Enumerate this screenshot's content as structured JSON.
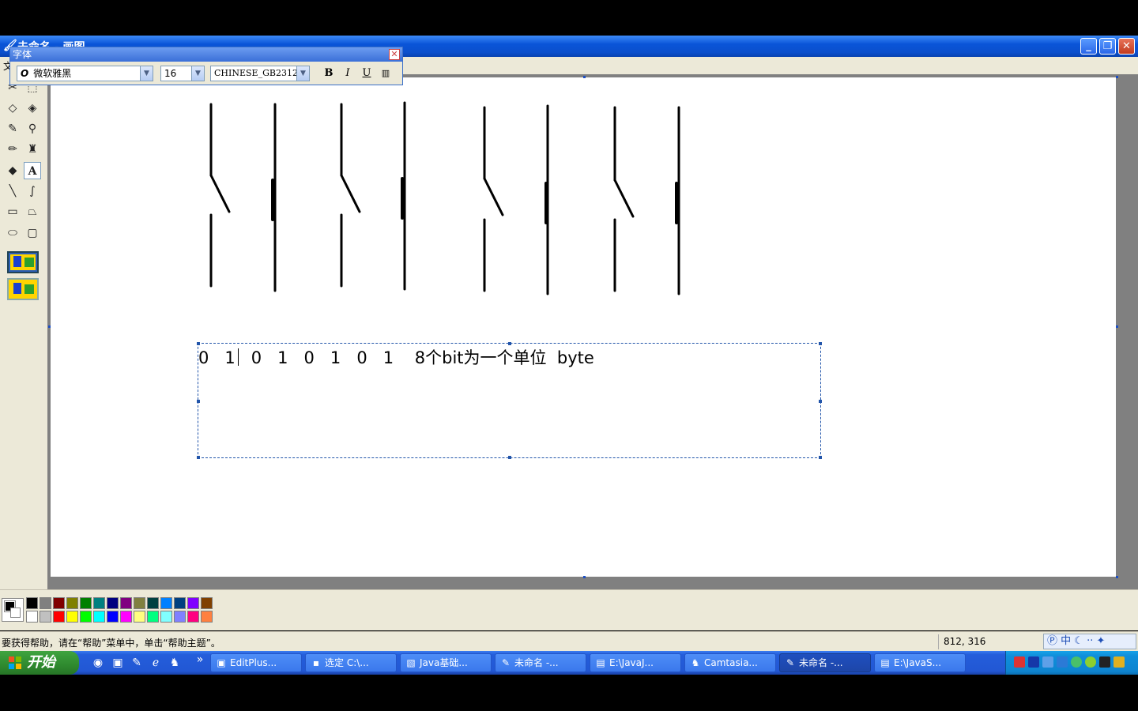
{
  "window": {
    "title": "未命名 - 画图"
  },
  "menu": {
    "first": "文"
  },
  "font_toolbar": {
    "title": "字体",
    "font_name": "微软雅黑",
    "font_size": "16",
    "charset": "CHINESE_GB2312",
    "bold": "B",
    "italic": "I",
    "underline": "U"
  },
  "tools": [
    "free-select",
    "select",
    "eraser",
    "fill",
    "picker",
    "magnifier",
    "pencil",
    "brush",
    "airbrush",
    "text",
    "line",
    "curve",
    "rectangle",
    "polygon",
    "ellipse",
    "rounded-rectangle"
  ],
  "canvas": {
    "text": "0   1   0   1   0   1   0   1    8个bit为一个单位  byte"
  },
  "palette": {
    "row1": [
      "#000000",
      "#808080",
      "#800000",
      "#808000",
      "#008000",
      "#008080",
      "#000080",
      "#800080",
      "#808040",
      "#004040",
      "#0080ff",
      "#004080",
      "#8000ff",
      "#804000"
    ],
    "row2": [
      "#ffffff",
      "#c0c0c0",
      "#ff0000",
      "#ffff00",
      "#00ff00",
      "#00ffff",
      "#0000ff",
      "#ff00ff",
      "#ffff80",
      "#00ff80",
      "#80ffff",
      "#8080ff",
      "#ff0080",
      "#ff8040"
    ]
  },
  "status": {
    "help": "要获得帮助，请在“帮助”菜单中，单击“帮助主题”。",
    "coords": "812, 316",
    "ime": "中"
  },
  "taskbar": {
    "start": "开始",
    "more": "»",
    "buttons": [
      {
        "label": "EditPlus..."
      },
      {
        "label": "选定 C:\\..."
      },
      {
        "label": "Java基础..."
      },
      {
        "label": "未命名 -..."
      },
      {
        "label": "E:\\JavaJ..."
      },
      {
        "label": "Camtasia..."
      },
      {
        "label": "未命名 -..."
      },
      {
        "label": "E:\\JavaS..."
      }
    ]
  }
}
